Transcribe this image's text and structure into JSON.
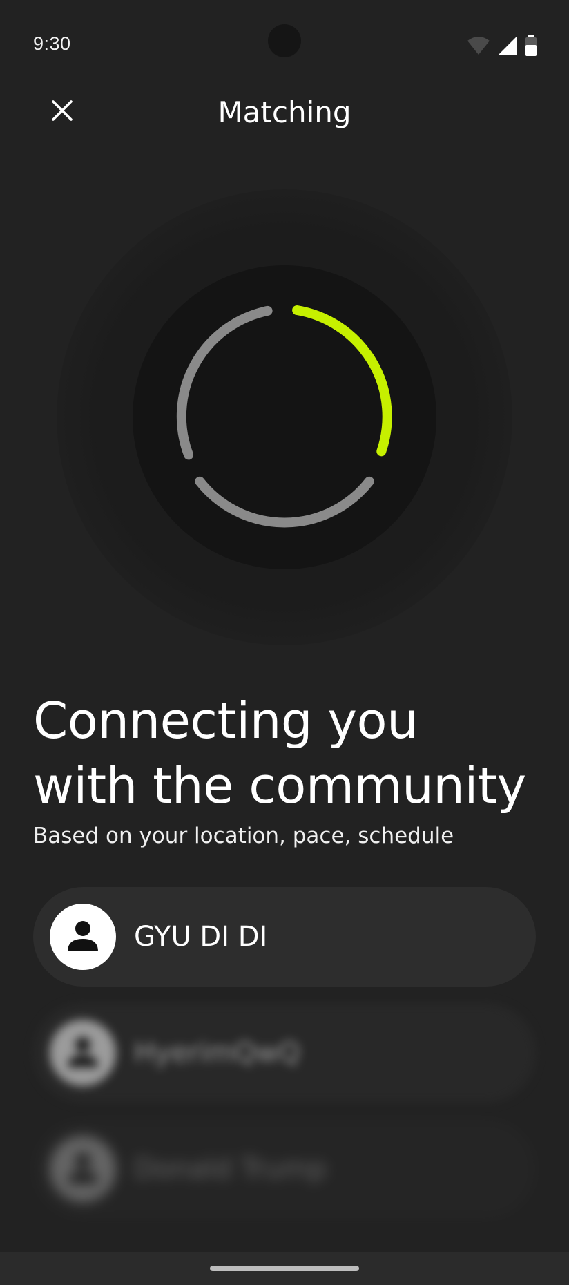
{
  "status_bar": {
    "time": "9:30",
    "icons": [
      "wifi-icon",
      "signal-icon",
      "battery-icon"
    ]
  },
  "app_bar": {
    "title": "Matching",
    "close_icon": "close-icon"
  },
  "spinner": {
    "accent_color": "#C6F000",
    "track_color": "#8A8A8A"
  },
  "headline": {
    "line1": "Connecting you",
    "line2": "with the community",
    "subtitle": "Based on your location, pace, schedule"
  },
  "members": [
    {
      "name": "GYU DI DI",
      "avatar_icon": "person-icon"
    },
    {
      "name": "HyerimQwQ",
      "avatar_icon": "person-icon"
    },
    {
      "name": "Donald Trump",
      "avatar_icon": "person-icon"
    }
  ]
}
